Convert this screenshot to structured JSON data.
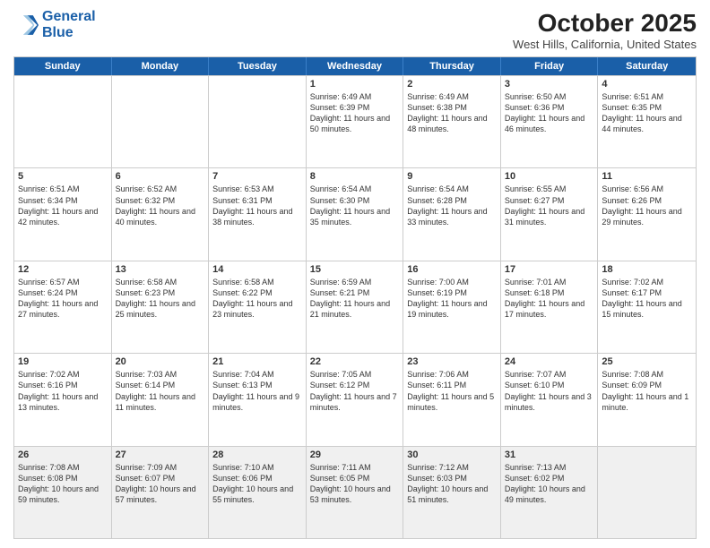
{
  "logo": {
    "line1": "General",
    "line2": "Blue"
  },
  "header": {
    "month": "October 2025",
    "location": "West Hills, California, United States"
  },
  "days_of_week": [
    "Sunday",
    "Monday",
    "Tuesday",
    "Wednesday",
    "Thursday",
    "Friday",
    "Saturday"
  ],
  "weeks": [
    [
      {
        "day": "",
        "detail": ""
      },
      {
        "day": "",
        "detail": ""
      },
      {
        "day": "",
        "detail": ""
      },
      {
        "day": "1",
        "detail": "Sunrise: 6:49 AM\nSunset: 6:39 PM\nDaylight: 11 hours and 50 minutes."
      },
      {
        "day": "2",
        "detail": "Sunrise: 6:49 AM\nSunset: 6:38 PM\nDaylight: 11 hours and 48 minutes."
      },
      {
        "day": "3",
        "detail": "Sunrise: 6:50 AM\nSunset: 6:36 PM\nDaylight: 11 hours and 46 minutes."
      },
      {
        "day": "4",
        "detail": "Sunrise: 6:51 AM\nSunset: 6:35 PM\nDaylight: 11 hours and 44 minutes."
      }
    ],
    [
      {
        "day": "5",
        "detail": "Sunrise: 6:51 AM\nSunset: 6:34 PM\nDaylight: 11 hours and 42 minutes."
      },
      {
        "day": "6",
        "detail": "Sunrise: 6:52 AM\nSunset: 6:32 PM\nDaylight: 11 hours and 40 minutes."
      },
      {
        "day": "7",
        "detail": "Sunrise: 6:53 AM\nSunset: 6:31 PM\nDaylight: 11 hours and 38 minutes."
      },
      {
        "day": "8",
        "detail": "Sunrise: 6:54 AM\nSunset: 6:30 PM\nDaylight: 11 hours and 35 minutes."
      },
      {
        "day": "9",
        "detail": "Sunrise: 6:54 AM\nSunset: 6:28 PM\nDaylight: 11 hours and 33 minutes."
      },
      {
        "day": "10",
        "detail": "Sunrise: 6:55 AM\nSunset: 6:27 PM\nDaylight: 11 hours and 31 minutes."
      },
      {
        "day": "11",
        "detail": "Sunrise: 6:56 AM\nSunset: 6:26 PM\nDaylight: 11 hours and 29 minutes."
      }
    ],
    [
      {
        "day": "12",
        "detail": "Sunrise: 6:57 AM\nSunset: 6:24 PM\nDaylight: 11 hours and 27 minutes."
      },
      {
        "day": "13",
        "detail": "Sunrise: 6:58 AM\nSunset: 6:23 PM\nDaylight: 11 hours and 25 minutes."
      },
      {
        "day": "14",
        "detail": "Sunrise: 6:58 AM\nSunset: 6:22 PM\nDaylight: 11 hours and 23 minutes."
      },
      {
        "day": "15",
        "detail": "Sunrise: 6:59 AM\nSunset: 6:21 PM\nDaylight: 11 hours and 21 minutes."
      },
      {
        "day": "16",
        "detail": "Sunrise: 7:00 AM\nSunset: 6:19 PM\nDaylight: 11 hours and 19 minutes."
      },
      {
        "day": "17",
        "detail": "Sunrise: 7:01 AM\nSunset: 6:18 PM\nDaylight: 11 hours and 17 minutes."
      },
      {
        "day": "18",
        "detail": "Sunrise: 7:02 AM\nSunset: 6:17 PM\nDaylight: 11 hours and 15 minutes."
      }
    ],
    [
      {
        "day": "19",
        "detail": "Sunrise: 7:02 AM\nSunset: 6:16 PM\nDaylight: 11 hours and 13 minutes."
      },
      {
        "day": "20",
        "detail": "Sunrise: 7:03 AM\nSunset: 6:14 PM\nDaylight: 11 hours and 11 minutes."
      },
      {
        "day": "21",
        "detail": "Sunrise: 7:04 AM\nSunset: 6:13 PM\nDaylight: 11 hours and 9 minutes."
      },
      {
        "day": "22",
        "detail": "Sunrise: 7:05 AM\nSunset: 6:12 PM\nDaylight: 11 hours and 7 minutes."
      },
      {
        "day": "23",
        "detail": "Sunrise: 7:06 AM\nSunset: 6:11 PM\nDaylight: 11 hours and 5 minutes."
      },
      {
        "day": "24",
        "detail": "Sunrise: 7:07 AM\nSunset: 6:10 PM\nDaylight: 11 hours and 3 minutes."
      },
      {
        "day": "25",
        "detail": "Sunrise: 7:08 AM\nSunset: 6:09 PM\nDaylight: 11 hours and 1 minute."
      }
    ],
    [
      {
        "day": "26",
        "detail": "Sunrise: 7:08 AM\nSunset: 6:08 PM\nDaylight: 10 hours and 59 minutes."
      },
      {
        "day": "27",
        "detail": "Sunrise: 7:09 AM\nSunset: 6:07 PM\nDaylight: 10 hours and 57 minutes."
      },
      {
        "day": "28",
        "detail": "Sunrise: 7:10 AM\nSunset: 6:06 PM\nDaylight: 10 hours and 55 minutes."
      },
      {
        "day": "29",
        "detail": "Sunrise: 7:11 AM\nSunset: 6:05 PM\nDaylight: 10 hours and 53 minutes."
      },
      {
        "day": "30",
        "detail": "Sunrise: 7:12 AM\nSunset: 6:03 PM\nDaylight: 10 hours and 51 minutes."
      },
      {
        "day": "31",
        "detail": "Sunrise: 7:13 AM\nSunset: 6:02 PM\nDaylight: 10 hours and 49 minutes."
      },
      {
        "day": "",
        "detail": ""
      }
    ]
  ]
}
